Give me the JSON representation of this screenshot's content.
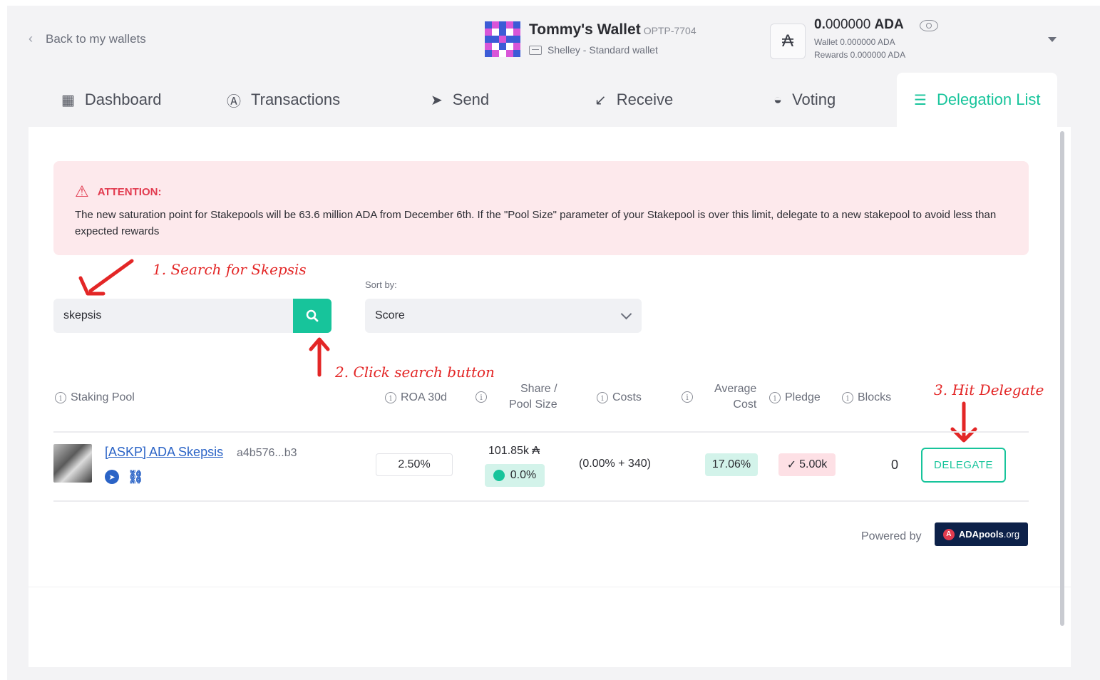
{
  "header": {
    "back_label": "Back to my wallets",
    "wallet_name": "Tommy's Wallet",
    "wallet_plate": "OPTP-7704",
    "wallet_type": "Shelley - Standard wallet",
    "ada_symbol": "₳",
    "balance_int": "0.",
    "balance_dec": "000000",
    "balance_unit": "ADA",
    "wallet_line": "Wallet 0.000000 ADA",
    "rewards_line": "Rewards 0.000000 ADA"
  },
  "tabs": [
    {
      "label": "Dashboard",
      "icon": "dashboard-icon"
    },
    {
      "label": "Transactions",
      "icon": "transactions-icon"
    },
    {
      "label": "Send",
      "icon": "send-icon"
    },
    {
      "label": "Receive",
      "icon": "receive-icon"
    },
    {
      "label": "Voting",
      "icon": "voting-icon"
    },
    {
      "label": "Delegation List",
      "icon": "list-icon",
      "active": true
    }
  ],
  "attention": {
    "title": "ATTENTION:",
    "body": "The new saturation point for Stakepools will be 63.6 million ADA from December 6th. If the \"Pool Size\" parameter of your Stakepool is over this limit, delegate to a new stakepool to avoid less than expected rewards"
  },
  "annotations": {
    "step1": "1. Search for Skepsis",
    "step2": "2. Click search button",
    "step3": "3. Hit Delegate"
  },
  "search": {
    "value": "skepsis",
    "sort_label": "Sort by:",
    "sort_value": "Score"
  },
  "table": {
    "headers": {
      "staking_pool": "Staking Pool",
      "roa": "ROA 30d",
      "share_line1": "Share /",
      "share_line2": "Pool Size",
      "costs": "Costs",
      "avg_line1": "Average",
      "avg_line2": "Cost",
      "pledge": "Pledge",
      "blocks": "Blocks"
    },
    "row": {
      "pool_name": "[ASKP] ADA Skepsis",
      "pool_hash": "a4b576...b3",
      "roa": "2.50%",
      "pool_size": "101.85k ₳",
      "share": "0.0%",
      "costs": "(0.00% + 340)",
      "avg_cost": "17.06%",
      "pledge": "5.00k",
      "blocks": "0",
      "action": "DELEGATE"
    }
  },
  "footer": {
    "powered_by": "Powered by",
    "brand_bold": "ADApools",
    "brand_suffix": ".org"
  },
  "colors": {
    "accent": "#17c49b",
    "alert": "#e23b4f",
    "annotation": "#e32626",
    "link": "#2a63c6"
  }
}
